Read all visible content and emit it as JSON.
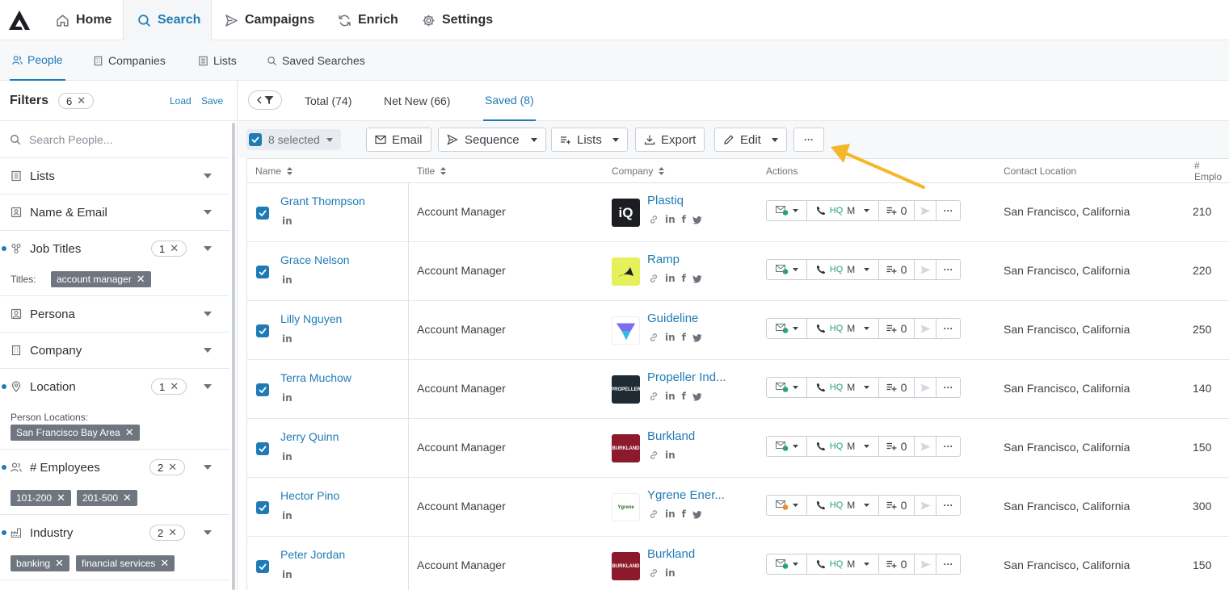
{
  "nav": {
    "items": [
      {
        "label": "Home",
        "icon": "home-icon"
      },
      {
        "label": "Search",
        "icon": "search-icon"
      },
      {
        "label": "Campaigns",
        "icon": "send-icon"
      },
      {
        "label": "Enrich",
        "icon": "refresh-icon"
      },
      {
        "label": "Settings",
        "icon": "gear-icon"
      }
    ],
    "active": "Search"
  },
  "subnav": {
    "items": [
      {
        "label": "People",
        "icon": "people-icon"
      },
      {
        "label": "Companies",
        "icon": "building-icon"
      },
      {
        "label": "Lists",
        "icon": "list-icon"
      },
      {
        "label": "Saved Searches",
        "icon": "saved-search-icon"
      }
    ],
    "active": "People"
  },
  "filters": {
    "title": "Filters",
    "count": "6",
    "load_label": "Load",
    "save_label": "Save",
    "search_placeholder": "Search People...",
    "groups": [
      {
        "label": "Lists",
        "icon": "list-icon"
      },
      {
        "label": "Name & Email",
        "icon": "id-card-icon"
      },
      {
        "label": "Job Titles",
        "icon": "org-icon",
        "count": "1",
        "sub_label": "Titles:",
        "chips": [
          "account manager"
        ]
      },
      {
        "label": "Persona",
        "icon": "persona-icon"
      },
      {
        "label": "Company",
        "icon": "building-icon"
      },
      {
        "label": "Location",
        "icon": "pin-icon",
        "count": "1",
        "sub_label": "Person Locations:",
        "chips": [
          "San Francisco Bay Area"
        ]
      },
      {
        "label": "# Employees",
        "icon": "people-icon",
        "count": "2",
        "chips": [
          "101-200",
          "201-500"
        ]
      },
      {
        "label": "Industry",
        "icon": "factory-icon",
        "count": "2",
        "chips": [
          "banking",
          "financial services"
        ]
      }
    ]
  },
  "tabs": {
    "items": [
      "Total (74)",
      "Net New (66)",
      "Saved (8)"
    ],
    "active": "Saved (8)"
  },
  "toolbar": {
    "selected_label": "8 selected",
    "email_label": "Email",
    "sequence_label": "Sequence",
    "lists_label": "Lists",
    "export_label": "Export",
    "edit_label": "Edit",
    "more_label": "···"
  },
  "table": {
    "columns": [
      "Name",
      "Title",
      "Company",
      "Actions",
      "Contact Location",
      "# Emplo"
    ],
    "rows": [
      {
        "name": "Grant Thompson",
        "title": "Account Manager",
        "company": "Plastiq",
        "logo_text": "iQ",
        "logo_color": "#1b1d20",
        "socials": [
          "link",
          "linkedin",
          "facebook",
          "twitter"
        ],
        "hq": "HQ",
        "m": "M",
        "seq_count": "0",
        "location": "San Francisco, California",
        "employees": "210",
        "email_status": "green"
      },
      {
        "name": "Grace Nelson",
        "title": "Account Manager",
        "company": "Ramp",
        "logo_text": "",
        "logo_color": "#e4f15a",
        "socials": [
          "link",
          "linkedin",
          "facebook",
          "twitter"
        ],
        "hq": "HQ",
        "m": "M",
        "seq_count": "0",
        "location": "San Francisco, California",
        "employees": "220",
        "email_status": "green"
      },
      {
        "name": "Lilly Nguyen",
        "title": "Account Manager",
        "company": "Guideline",
        "logo_text": "",
        "logo_color": "#ffffff",
        "socials": [
          "link",
          "linkedin",
          "facebook",
          "twitter"
        ],
        "hq": "HQ",
        "m": "M",
        "seq_count": "0",
        "location": "San Francisco, California",
        "employees": "250",
        "email_status": "green"
      },
      {
        "name": "Terra Muchow",
        "title": "Account Manager",
        "company": "Propeller Ind...",
        "logo_text": "PROPELLER",
        "logo_color": "#1f2a33",
        "socials": [
          "link",
          "linkedin",
          "facebook",
          "twitter"
        ],
        "hq": "HQ",
        "m": "M",
        "seq_count": "0",
        "location": "San Francisco, California",
        "employees": "140",
        "email_status": "green"
      },
      {
        "name": "Jerry Quinn",
        "title": "Account Manager",
        "company": "Burkland",
        "logo_text": "BURKLAND",
        "logo_color": "#8c1a2c",
        "socials": [
          "link",
          "linkedin"
        ],
        "hq": "HQ",
        "m": "M",
        "seq_count": "0",
        "location": "San Francisco, California",
        "employees": "150",
        "email_status": "green"
      },
      {
        "name": "Hector Pino",
        "title": "Account Manager",
        "company": "Ygrene Ener...",
        "logo_text": "Ygrene",
        "logo_color": "#ffffff",
        "socials": [
          "link",
          "linkedin",
          "facebook",
          "twitter"
        ],
        "hq": "HQ",
        "m": "M",
        "seq_count": "0",
        "location": "San Francisco, California",
        "employees": "300",
        "email_status": "orange"
      },
      {
        "name": "Peter Jordan",
        "title": "Account Manager",
        "company": "Burkland",
        "logo_text": "BURKLAND",
        "logo_color": "#8c1a2c",
        "socials": [
          "link",
          "linkedin"
        ],
        "hq": "HQ",
        "m": "M",
        "seq_count": "0",
        "location": "San Francisco, California",
        "employees": "150",
        "email_status": "green"
      }
    ]
  },
  "colors": {
    "accent": "#1f7bb6",
    "chip": "#6f7680",
    "hq": "#27a37a",
    "annotation_arrow": "#f5b72a"
  }
}
